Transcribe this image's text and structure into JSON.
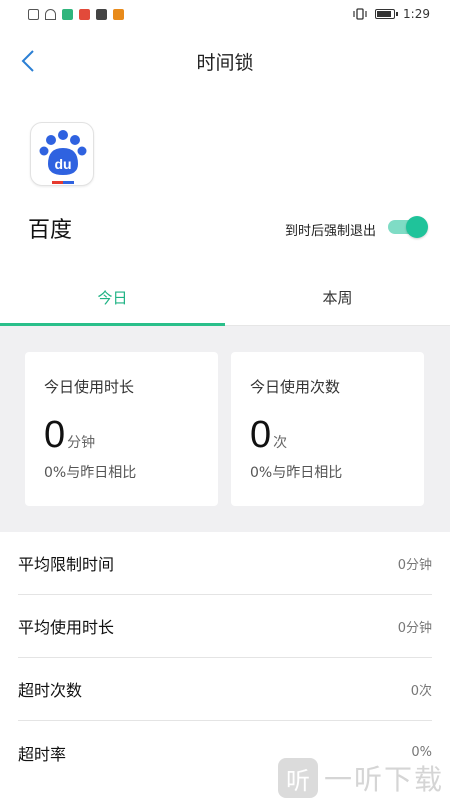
{
  "statusbar": {
    "time": "1:29"
  },
  "header": {
    "title": "时间锁"
  },
  "app": {
    "name": "百度",
    "icon": "baidu-paw-icon",
    "force_exit_label": "到时后强制退出",
    "force_exit_on": true
  },
  "tabs": [
    {
      "label": "今日",
      "active": true
    },
    {
      "label": "本周",
      "active": false
    }
  ],
  "stats": {
    "duration": {
      "title": "今日使用时长",
      "value": "0",
      "unit": "分钟",
      "compare": "0%与昨日相比"
    },
    "count": {
      "title": "今日使用次数",
      "value": "0",
      "unit": "次",
      "compare": "0%与昨日相比"
    }
  },
  "list": [
    {
      "label": "平均限制时间",
      "value": "0分钟"
    },
    {
      "label": "平均使用时长",
      "value": "0分钟"
    },
    {
      "label": "超时次数",
      "value": "0次"
    },
    {
      "label": "超时率",
      "value": "0%"
    }
  ],
  "watermark": {
    "text": "一听下载",
    "glyph": "听"
  },
  "colors": {
    "accent": "#1fb384",
    "toggle_on": "#1fc39a",
    "back_arrow": "#2b7fd4"
  }
}
